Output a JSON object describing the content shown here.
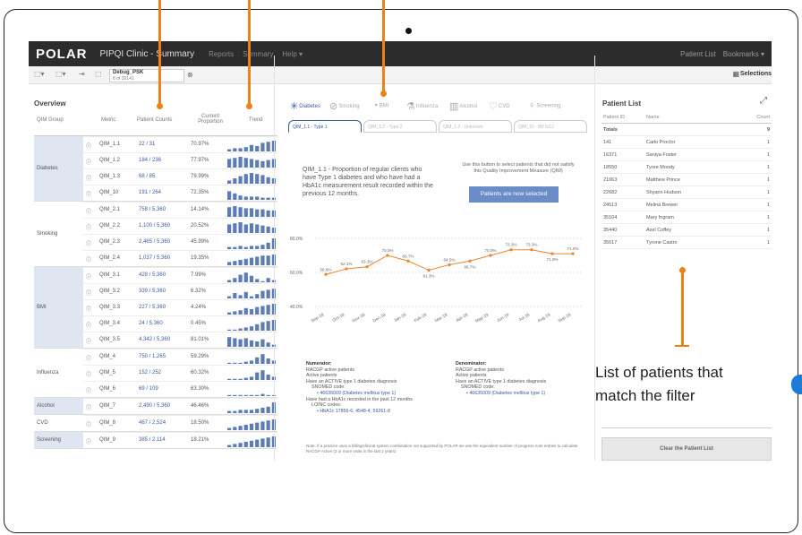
{
  "navbar": {
    "logo": "POLAR",
    "title": "PIPQI Clinic - Summary",
    "links": [
      "Reports",
      "Summary",
      "Help ▾"
    ],
    "right": [
      "Patient List",
      "Bookmarks ▾"
    ]
  },
  "toolbar": {
    "chip_title": "Debug_PSK",
    "chip_sub": "8 of 39141",
    "selections": "Selections"
  },
  "overview": {
    "title": "Overview",
    "headers": [
      "QIM Group",
      "Metric",
      "Patient Counts",
      "Current Proportion",
      "Trend"
    ],
    "groups": [
      {
        "name": "Diabetes",
        "highlight": true,
        "rows": [
          {
            "metric": "QIM_1.1",
            "counts": "22 / 31",
            "prop": "70.97%",
            "trend": [
              2,
              3,
              3,
              4,
              6,
              5,
              8,
              9,
              10
            ]
          },
          {
            "metric": "QIM_1.2",
            "counts": "184 / 236",
            "prop": "77.97%",
            "trend": [
              8,
              9,
              10,
              9,
              8,
              7,
              6,
              7,
              8
            ]
          },
          {
            "metric": "QIM_1.3",
            "counts": "68 / 85",
            "prop": "79.99%",
            "trend": [
              3,
              5,
              7,
              9,
              10,
              9,
              8,
              6,
              5
            ]
          },
          {
            "metric": "QIM_10",
            "counts": "191 / 264",
            "prop": "72.35%",
            "trend": [
              8,
              6,
              4,
              3,
              3,
              3,
              2,
              2,
              2
            ]
          }
        ]
      },
      {
        "name": "Smoking",
        "highlight": false,
        "rows": [
          {
            "metric": "QIM_2.1",
            "counts": "758 / 5,360",
            "prop": "14.14%",
            "trend": [
              9,
              10,
              9,
              8,
              8,
              7,
              7,
              6,
              6
            ]
          },
          {
            "metric": "QIM_2.2",
            "counts": "1,100 / 5,360",
            "prop": "20.52%",
            "trend": [
              8,
              9,
              10,
              8,
              9,
              8,
              7,
              6,
              5
            ]
          },
          {
            "metric": "QIM_2.3",
            "counts": "2,465 / 5,360",
            "prop": "45.99%",
            "trend": [
              2,
              2,
              3,
              2,
              3,
              3,
              4,
              6,
              10
            ]
          },
          {
            "metric": "QIM_2.4",
            "counts": "1,037 / 5,360",
            "prop": "19.35%",
            "trend": [
              3,
              4,
              5,
              6,
              7,
              8,
              9,
              9,
              10
            ]
          }
        ]
      },
      {
        "name": "BMI",
        "highlight": true,
        "rows": [
          {
            "metric": "QIM_3.1",
            "counts": "428 / 5,360",
            "prop": "7.99%",
            "trend": [
              2,
              4,
              7,
              9,
              6,
              3,
              1,
              4,
              2
            ]
          },
          {
            "metric": "QIM_3.2",
            "counts": "339 / 5,360",
            "prop": "6.32%",
            "trend": [
              2,
              5,
              3,
              6,
              2,
              4,
              7,
              8,
              9
            ]
          },
          {
            "metric": "QIM_3.3",
            "counts": "227 / 5,360",
            "prop": "4.24%",
            "trend": [
              2,
              3,
              4,
              6,
              5,
              7,
              8,
              9,
              10
            ]
          },
          {
            "metric": "QIM_3.4",
            "counts": "24 / 5,360",
            "prop": "0.45%",
            "trend": [
              1,
              1,
              2,
              3,
              4,
              6,
              8,
              9,
              10
            ]
          },
          {
            "metric": "QIM_3.5",
            "counts": "4,342 / 5,360",
            "prop": "81.01%",
            "trend": [
              9,
              8,
              7,
              8,
              6,
              5,
              7,
              4,
              2
            ]
          }
        ]
      },
      {
        "name": "Influenza",
        "highlight": false,
        "rows": [
          {
            "metric": "QIM_4",
            "counts": "750 / 1,265",
            "prop": "59.29%",
            "trend": [
              1,
              1,
              1,
              2,
              3,
              6,
              9,
              5,
              3
            ]
          },
          {
            "metric": "QIM_5",
            "counts": "152 / 252",
            "prop": "60.32%",
            "trend": [
              1,
              1,
              1,
              2,
              3,
              7,
              9,
              5,
              3
            ]
          },
          {
            "metric": "QIM_6",
            "counts": "69 / 109",
            "prop": "63.30%",
            "trend": [
              1,
              1,
              1,
              1,
              1,
              1,
              2,
              1,
              1
            ]
          }
        ]
      },
      {
        "name": "Alcohol",
        "highlight": true,
        "rows": [
          {
            "metric": "QIM_7",
            "counts": "2,490 / 5,360",
            "prop": "46.46%",
            "trend": [
              2,
              2,
              3,
              3,
              3,
              4,
              5,
              6,
              10
            ]
          }
        ]
      },
      {
        "name": "CVD",
        "highlight": false,
        "rows": [
          {
            "metric": "QIM_8",
            "counts": "467 / 2,524",
            "prop": "18.50%",
            "trend": [
              2,
              3,
              4,
              5,
              6,
              7,
              8,
              9,
              10
            ]
          }
        ]
      },
      {
        "name": "Screening",
        "highlight": true,
        "rows": [
          {
            "metric": "QIM_9",
            "counts": "385 / 2,114",
            "prop": "18.21%",
            "trend": [
              2,
              3,
              4,
              5,
              6,
              7,
              8,
              9,
              10
            ]
          }
        ]
      }
    ]
  },
  "tabs": {
    "icons": [
      {
        "label": "Diabetes",
        "glyph": "✳",
        "active": true
      },
      {
        "label": "Smoking",
        "glyph": "⊘",
        "active": false
      },
      {
        "label": "BMI",
        "glyph": "◔",
        "active": false
      },
      {
        "label": "Influenza",
        "glyph": "⚗",
        "active": false
      },
      {
        "label": "Alcohol",
        "glyph": "▥",
        "active": false
      },
      {
        "label": "CVD",
        "glyph": "♡",
        "active": false
      },
      {
        "label": "Screening",
        "glyph": "♀",
        "active": false
      }
    ],
    "sub": [
      "QIM_1.1 - Type 1",
      "QIM_1.2 - Type 2",
      "QIM_1.3 - Unknown",
      "QIM_10 - BP 6/12"
    ]
  },
  "detail": {
    "description": "QIM_1.1 - Proportion of regular clients who have Type 1 diabetes and who have had a HbA1c measurement result recorded within the previous 12 months.",
    "button_note": "Use this button to select patients that did not satisfy this Quality Improvement Measure (QIM)",
    "button_label": "Patients are now selected"
  },
  "chart_data": {
    "type": "line",
    "x": [
      "Sep-18",
      "Oct-18",
      "Nov-18",
      "Dec-18",
      "Jan-19",
      "Feb-19",
      "Mar-19",
      "Apr-19",
      "May-19",
      "Jun-19",
      "Jul-19",
      "Aug-19",
      "Sep-19"
    ],
    "values": [
      58.8,
      62.1,
      63.3,
      70.0,
      66.7,
      61.3,
      64.5,
      66.7,
      70.0,
      73.3,
      73.3,
      71.0,
      71.0
    ],
    "labels": [
      "58.8%",
      "62.1%",
      "63.3%",
      "70.0%",
      "66.7%",
      "61.3%",
      "64.5%",
      "66.7%",
      "70.0%",
      "73.3%",
      "73.3%",
      "71.0%",
      "71.0%"
    ],
    "yticks": [
      "80.0%",
      "60.0%",
      "40.0%"
    ],
    "ylim": [
      40,
      80
    ]
  },
  "numerator": {
    "title": "Numerator:",
    "lines": [
      "RACGP active patients",
      "Active patients",
      "Have an ACTIVE type 1 diabetes diagnosis",
      "SNOMED code:",
      "• 46635009 (Diabetes mellitus type 1)",
      "Have had a HbA1c recorded in the past 12 months",
      "LOINC codes:",
      "• HbA1c 17856-6, 4548-4, 59261-8"
    ]
  },
  "denominator": {
    "title": "Denominator:",
    "lines": [
      "RACGP active patients",
      "Active patients",
      "Have an ACTIVE type 1 diabetes diagnosis",
      "SNOMED code:",
      "• 46635009 (Diabetes mellitus type 1)"
    ]
  },
  "note": "Note: If a practice uses a billing/clinical system combination not supported by POLAR we use the equivalent number of progress note entries to calculate RACGP Active (3 or more visits in the last 2 years)",
  "patient_list": {
    "title": "Patient List",
    "headers": [
      "Patient ID",
      "Name",
      "Count"
    ],
    "totals": [
      "Totals",
      "",
      "9"
    ],
    "rows": [
      [
        "141",
        "Carlo Proctor",
        "1"
      ],
      [
        "16371",
        "Saniya Foster",
        "1"
      ],
      [
        "18550",
        "Tyree Moody",
        "1"
      ],
      [
        "21063",
        "Matthew Prince",
        "1"
      ],
      [
        "22682",
        "Shyann Hudson",
        "1"
      ],
      [
        "24513",
        "Melina Brewer",
        "1"
      ],
      [
        "35104",
        "Mary Ingram",
        "1"
      ],
      [
        "35440",
        "Axel Coffey",
        "1"
      ],
      [
        "35617",
        "Tyrone Castro",
        "1"
      ]
    ],
    "clear_button": "Clear the Patient List"
  },
  "annotation": {
    "text": "List of patients that match the filter",
    "color": "#f07f18"
  }
}
